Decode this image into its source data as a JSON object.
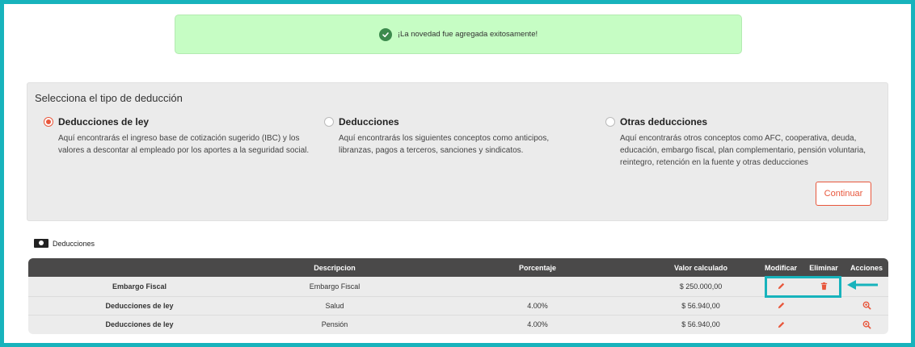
{
  "toast": {
    "message": "¡La novedad fue agregada exitosamente!",
    "color": "#c6fdc4"
  },
  "deduction_panel": {
    "title": "Selecciona el tipo de deducción",
    "options": [
      {
        "label": "Deducciones de ley",
        "selected": true,
        "description": "Aquí encontrarás el ingreso base de cotización sugerido (IBC) y los valores a descontar al empleado por los aportes a la seguridad social."
      },
      {
        "label": "Deducciones",
        "selected": false,
        "description": "Aquí encontrarás los siguientes conceptos como anticipos, libranzas, pagos a terceros, sanciones y sindicatos."
      },
      {
        "label": "Otras deducciones",
        "selected": false,
        "description": "Aquí encontrarás otros conceptos como AFC, cooperativa, deuda, educación, embargo fiscal, plan complementario, pensión voluntaria, reintegro, retención en la fuente y otras deducciones"
      }
    ],
    "continue_label": "Continuar",
    "accent_color": "#e8573c"
  },
  "deductions_table": {
    "section_label": "Deducciones",
    "section_icon": "money-icon",
    "headers": {
      "concept": "",
      "description": "Descripcion",
      "percentage": "Porcentaje",
      "value": "Valor calculado",
      "modify": "Modificar",
      "delete": "Eliminar",
      "actions": "Acciones"
    },
    "rows": [
      {
        "concept": "Embargo Fiscal",
        "description": "Embargo Fiscal",
        "percentage": "",
        "value": "$ 250.000,00",
        "has_delete": true,
        "has_action": false
      },
      {
        "concept": "Deducciones de ley",
        "description": "Salud",
        "percentage": "4.00%",
        "value": "$ 56.940,00",
        "has_delete": false,
        "has_action": true
      },
      {
        "concept": "Deducciones de ley",
        "description": "Pensión",
        "percentage": "4.00%",
        "value": "$ 56.940,00",
        "has_delete": false,
        "has_action": true
      }
    ]
  },
  "highlight_color": "#17b3bc"
}
